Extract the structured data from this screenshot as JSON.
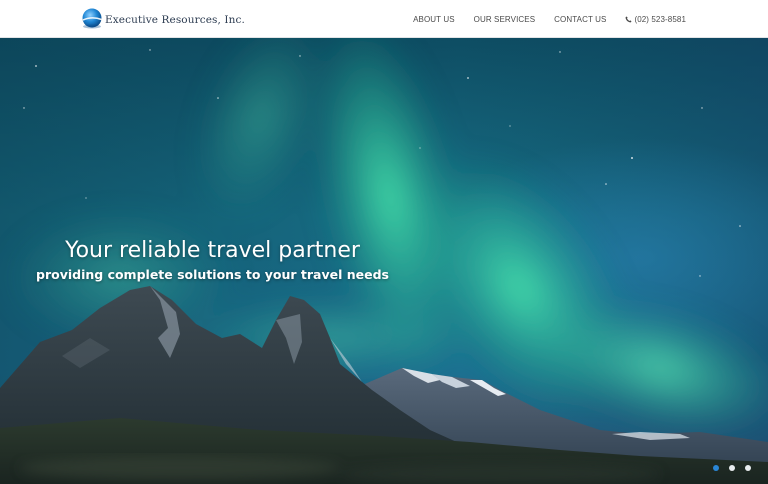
{
  "header": {
    "logo_text": "Executive Resources, Inc.",
    "nav": [
      {
        "label": "ABOUT US"
      },
      {
        "label": "OUR SERVICES"
      },
      {
        "label": "CONTACT US"
      }
    ],
    "phone": {
      "icon": "phone-icon",
      "number": "(02) 523-8581"
    }
  },
  "hero": {
    "title": "Your reliable travel partner",
    "subtitle": "providing complete solutions to your travel needs",
    "carousel": {
      "slide_count": 3,
      "active_index": 0,
      "active_color": "#2a86d6",
      "inactive_color": "#e8ecef"
    }
  },
  "colors": {
    "header_bg": "#ffffff",
    "nav_text": "#4a4a4a",
    "logo_text": "#2e3d52",
    "logo_blue": "#1f86d4"
  }
}
